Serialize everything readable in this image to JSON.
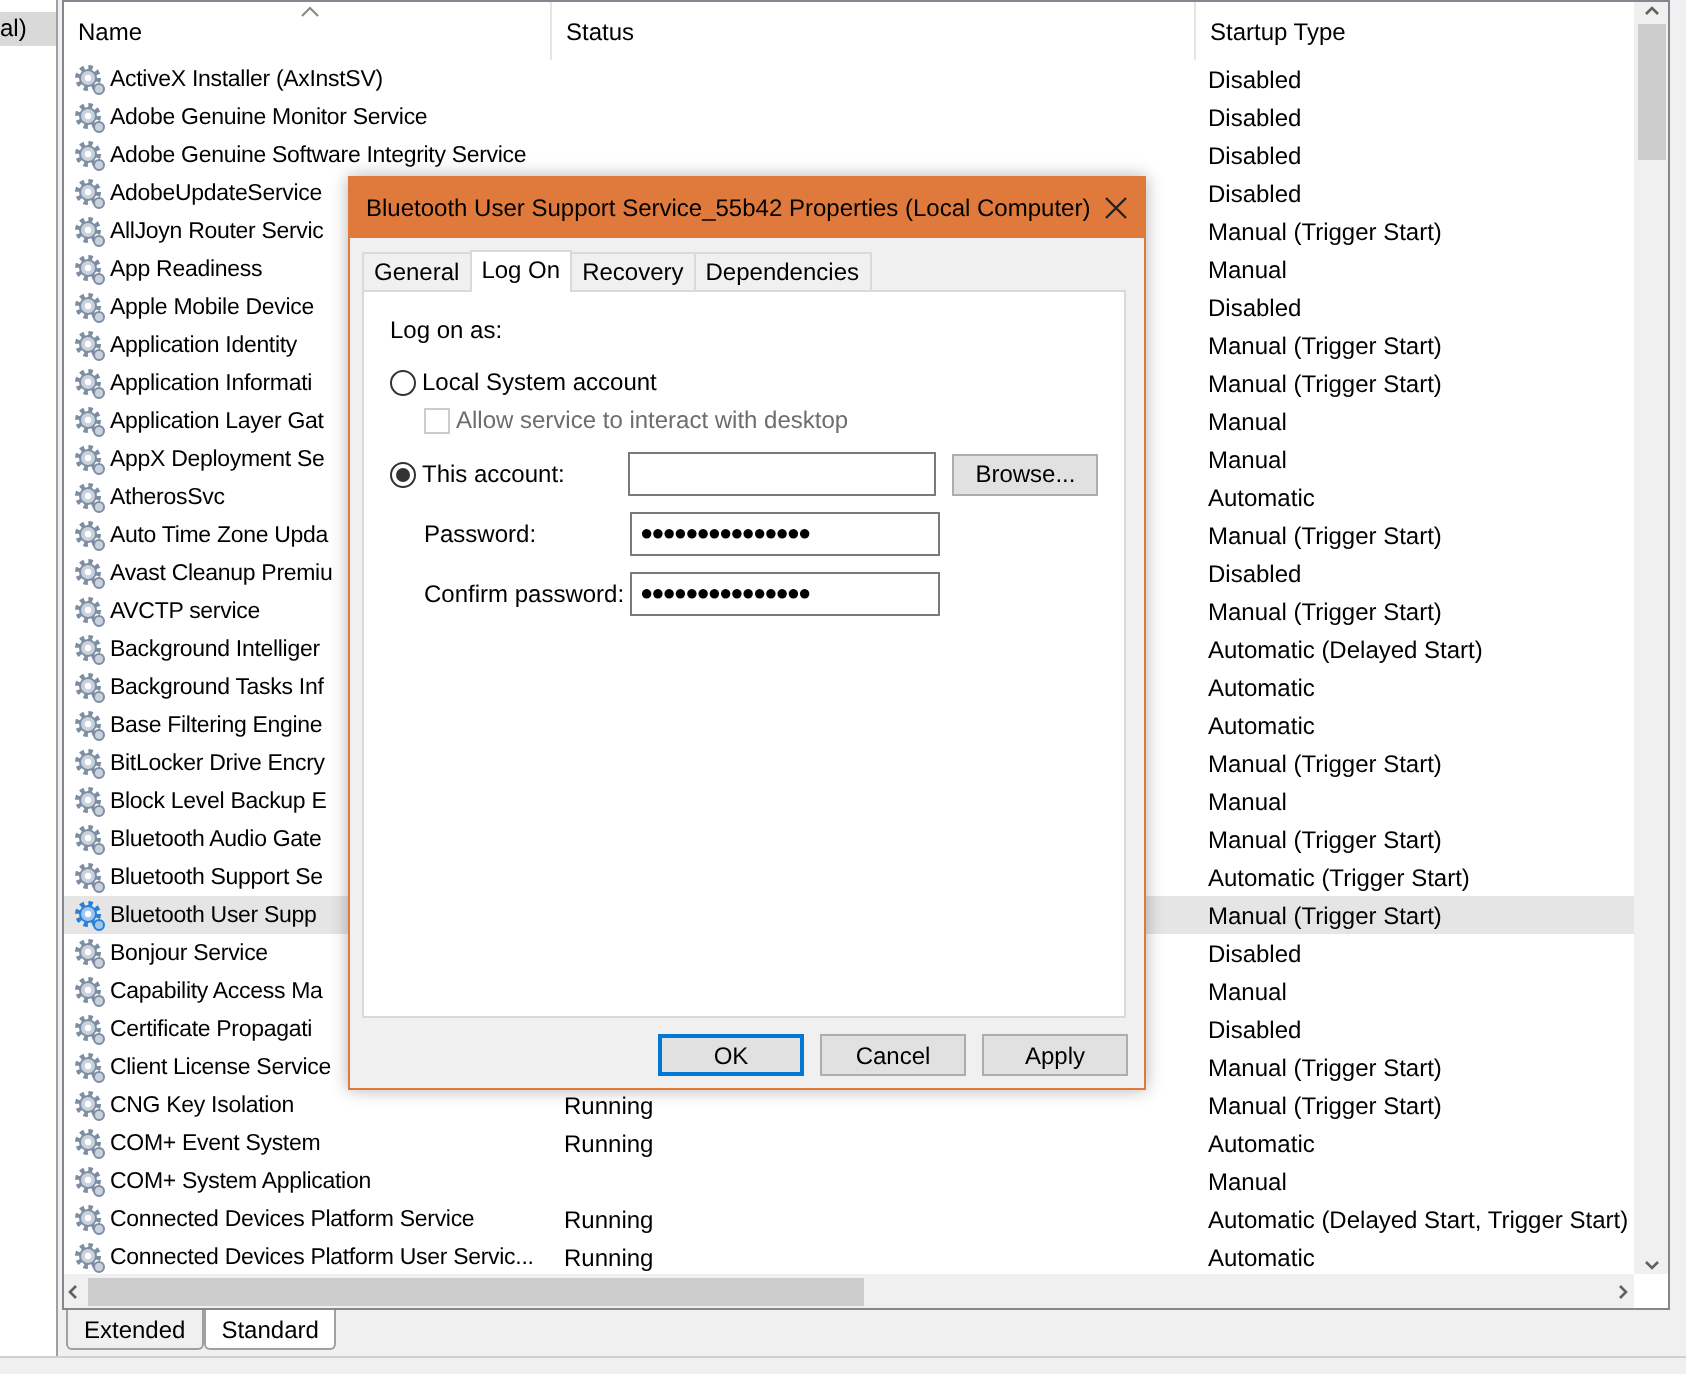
{
  "tree": {
    "label": "al)",
    "selected": true
  },
  "table": {
    "columns": [
      {
        "label": "Name",
        "sorted": true
      },
      {
        "label": "Status",
        "sorted": false
      },
      {
        "label": "Startup Type",
        "sorted": false
      }
    ],
    "rows": [
      {
        "name": "ActiveX Installer (AxInstSV)",
        "startup": "Disabled",
        "selected": false
      },
      {
        "name": "Adobe Genuine Monitor Service",
        "startup": "Disabled",
        "selected": false
      },
      {
        "name": "Adobe Genuine Software Integrity Service",
        "startup": "Disabled",
        "selected": false
      },
      {
        "name": "AdobeUpdateService",
        "startup": "Disabled",
        "selected": false
      },
      {
        "name": "AllJoyn Router Servic",
        "startup": "Manual (Trigger Start)",
        "selected": false
      },
      {
        "name": "App Readiness",
        "startup": "Manual",
        "selected": false
      },
      {
        "name": "Apple Mobile Device",
        "startup": "Disabled",
        "selected": false
      },
      {
        "name": "Application Identity",
        "startup": "Manual (Trigger Start)",
        "selected": false
      },
      {
        "name": "Application Informati",
        "startup": "Manual (Trigger Start)",
        "selected": false
      },
      {
        "name": "Application Layer Gat",
        "startup": "Manual",
        "selected": false
      },
      {
        "name": "AppX Deployment Se",
        "startup": "Manual",
        "selected": false
      },
      {
        "name": "AtherosSvc",
        "startup": "Automatic",
        "selected": false
      },
      {
        "name": "Auto Time Zone Upda",
        "startup": "Manual (Trigger Start)",
        "selected": false
      },
      {
        "name": "Avast Cleanup Premiu",
        "startup": "Disabled",
        "selected": false
      },
      {
        "name": "AVCTP service",
        "startup": "Manual (Trigger Start)",
        "selected": false
      },
      {
        "name": "Background Intelliger",
        "startup": "Automatic (Delayed Start)",
        "selected": false
      },
      {
        "name": "Background Tasks Inf",
        "startup": "Automatic",
        "selected": false
      },
      {
        "name": "Base Filtering Engine",
        "startup": "Automatic",
        "selected": false
      },
      {
        "name": "BitLocker Drive Encry",
        "startup": "Manual (Trigger Start)",
        "selected": false
      },
      {
        "name": "Block Level Backup E",
        "startup": "Manual",
        "selected": false
      },
      {
        "name": "Bluetooth Audio Gate",
        "startup": "Manual (Trigger Start)",
        "selected": false
      },
      {
        "name": "Bluetooth Support Se",
        "startup": "Automatic (Trigger Start)",
        "selected": false
      },
      {
        "name": "Bluetooth User Supp",
        "startup": "Manual (Trigger Start)",
        "selected": true
      },
      {
        "name": "Bonjour Service",
        "startup": "Disabled",
        "selected": false
      },
      {
        "name": "Capability Access Ma",
        "startup": "Manual",
        "selected": false
      },
      {
        "name": "Certificate Propagati",
        "startup": "Disabled",
        "selected": false
      },
      {
        "name": "Client License Service",
        "startup": "Manual (Trigger Start)",
        "selected": false
      },
      {
        "name": "CNG Key Isolation",
        "status": "Running",
        "startup": "Manual (Trigger Start)",
        "selected": false
      },
      {
        "name": "COM+ Event System",
        "status": "Running",
        "startup": "Automatic",
        "selected": false
      },
      {
        "name": "COM+ System Application",
        "startup": "Manual",
        "selected": false
      },
      {
        "name": "Connected Devices Platform Service",
        "status": "Running",
        "startup": "Automatic (Delayed Start, Trigger Start)",
        "selected": false
      },
      {
        "name": "Connected Devices Platform User Servic...",
        "status": "Running",
        "startup": "Automatic",
        "selected": false
      }
    ]
  },
  "view_tabs": [
    {
      "label": "Extended",
      "selected": false
    },
    {
      "label": "Standard",
      "selected": true
    }
  ],
  "dialog": {
    "title": "Bluetooth User Support Service_55b42 Properties (Local Computer)",
    "tabs": [
      {
        "label": "General",
        "selected": false
      },
      {
        "label": "Log On",
        "selected": true
      },
      {
        "label": "Recovery",
        "selected": false
      },
      {
        "label": "Dependencies",
        "selected": false
      }
    ],
    "logon_label": "Log on as:",
    "local_system": {
      "label": "Local System account",
      "selected": false,
      "interact": {
        "label": "Allow service to interact with desktop",
        "checked": false,
        "disabled": true
      }
    },
    "this_account": {
      "label": "This account:",
      "selected": true,
      "browse": "Browse..."
    },
    "password": {
      "label": "Password:",
      "value": "●●●●●●●●●●●●●●●"
    },
    "confirm": {
      "label": "Confirm password:",
      "value": "●●●●●●●●●●●●●●●"
    },
    "buttons": [
      {
        "label": "OK",
        "default": true
      },
      {
        "label": "Cancel",
        "default": false
      },
      {
        "label": "Apply",
        "default": false
      }
    ]
  }
}
